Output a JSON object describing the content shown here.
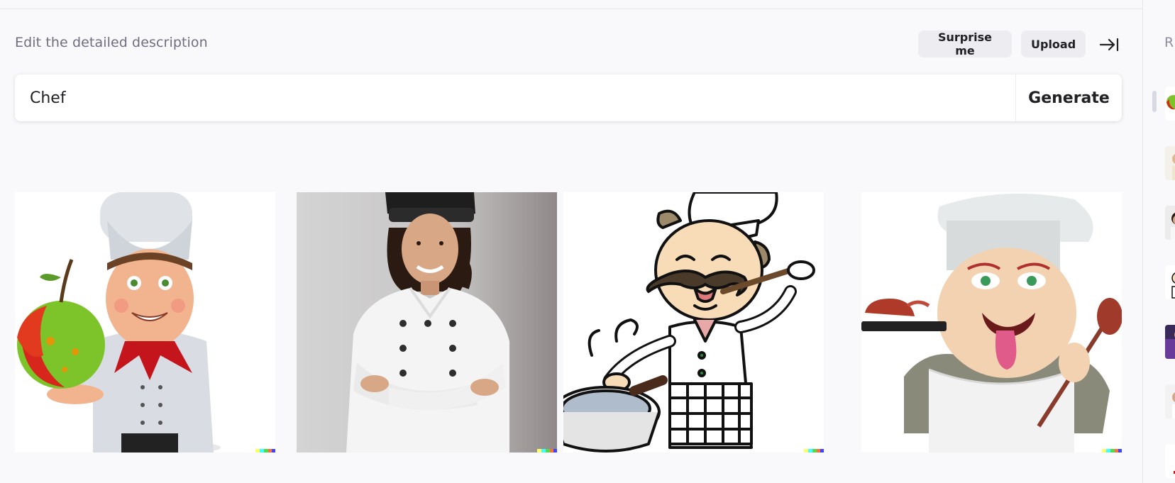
{
  "header": {
    "label": "Edit the detailed description",
    "surprise_label": "Surprise me",
    "upload_label": "Upload"
  },
  "prompt": {
    "value": "Chef",
    "generate_label": "Generate"
  },
  "results": [
    {
      "name": "result-image-cartoon-chef-apple"
    },
    {
      "name": "result-image-photo-chef-woman"
    },
    {
      "name": "result-image-drawing-chef-mustache"
    },
    {
      "name": "result-image-cartoon-chef-tongue"
    }
  ],
  "sidebar": {
    "title": "R"
  },
  "icons": {
    "collapse": "arrow-right-to-bar-icon"
  }
}
